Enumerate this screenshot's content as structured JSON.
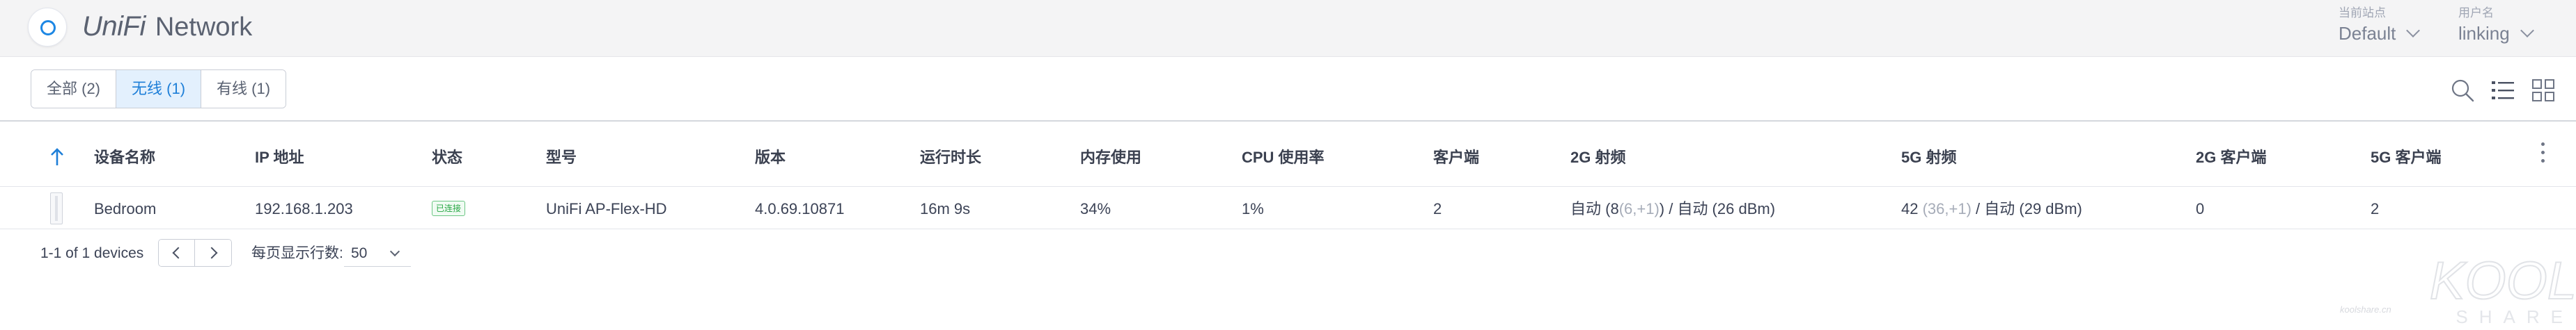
{
  "header": {
    "brand": "UniFi",
    "product": "Network",
    "site": {
      "caption": "当前站点",
      "value": "Default"
    },
    "user": {
      "caption": "用户名",
      "value": "linking"
    }
  },
  "filter_tabs": [
    {
      "label": "全部 (2)",
      "active": false
    },
    {
      "label": "无线 (1)",
      "active": true
    },
    {
      "label": "有线 (1)",
      "active": false
    }
  ],
  "toolbar_icons": [
    "search-icon",
    "list-view-icon",
    "grid-view-icon"
  ],
  "table": {
    "columns": [
      "设备名称",
      "IP 地址",
      "状态",
      "型号",
      "版本",
      "运行时长",
      "内存使用",
      "CPU 使用率",
      "客户端",
      "2G 射频",
      "5G 射频",
      "2G 客户端",
      "5G 客户端"
    ],
    "rows": [
      {
        "name": "Bedroom",
        "ip": "192.168.1.203",
        "status": "已连接",
        "model": "UniFi AP-Flex-HD",
        "version": "4.0.69.10871",
        "uptime": "16m 9s",
        "memory": "34%",
        "cpu": "1%",
        "clients": "2",
        "radio_2g": {
          "prefix": "自动 (8",
          "detail": "(6,+1)",
          "suffix": ") / 自动 (26 dBm)"
        },
        "radio_5g": {
          "prefix": "42",
          "detail": "(36,+1)",
          "suffix": " / 自动 (29 dBm)"
        },
        "clients_2g": "0",
        "clients_5g": "2"
      }
    ]
  },
  "pagination": {
    "count_text": "1-1 of 1 devices",
    "rows_per_page_label": "每页显示行数:",
    "rows_per_page_value": "50"
  },
  "watermark": {
    "text": "KOOL",
    "sub": "SHARE",
    "small": "koolshare.cn"
  },
  "colors": {
    "accent": "#1e7fd8",
    "active_tab_bg": "#e3f0fd",
    "status_green": "#27a744",
    "topbar_bg": "#f4f4f5"
  }
}
